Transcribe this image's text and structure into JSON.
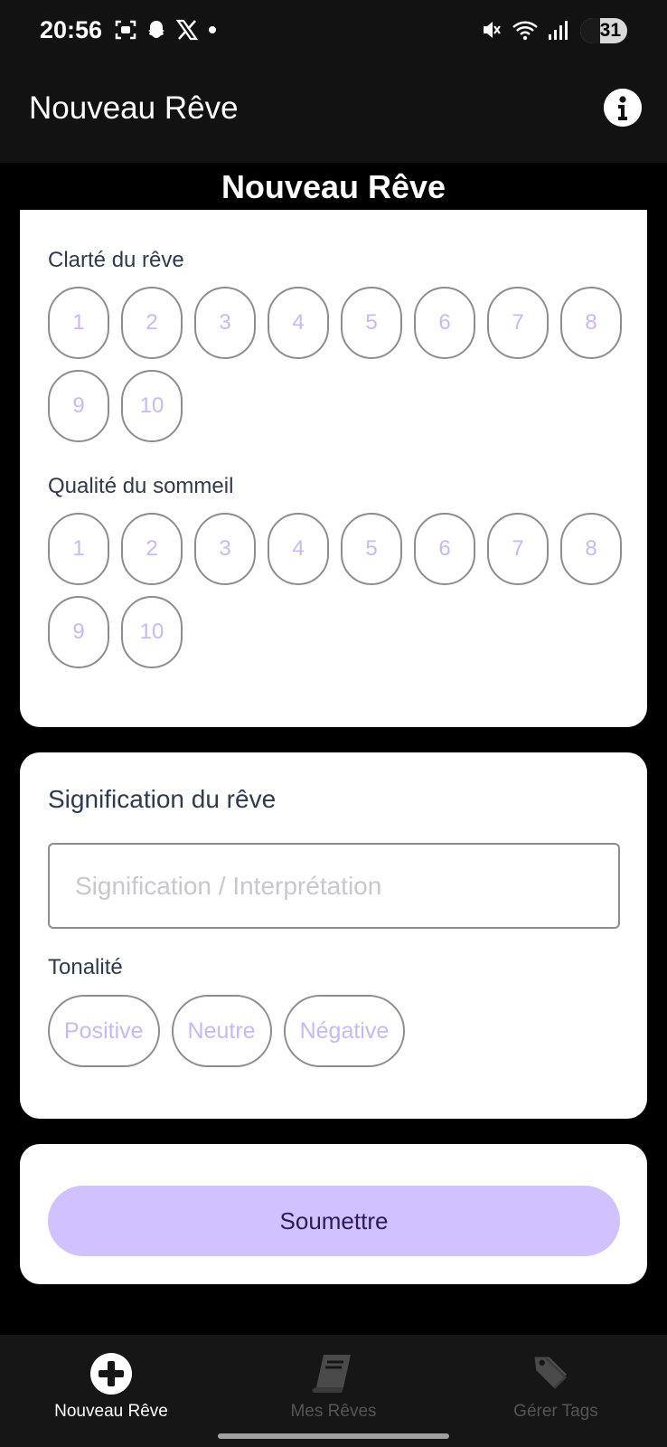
{
  "status": {
    "time": "20:56",
    "battery": "31",
    "left_icons": [
      "screenshot-icon",
      "snapchat-icon",
      "x-logo-icon",
      "dot-icon"
    ],
    "right_icons": [
      "mute-icon",
      "wifi-icon",
      "signal-icon"
    ]
  },
  "appbar": {
    "title": "Nouveau Rêve",
    "info_icon": "info-icon"
  },
  "page": {
    "heading": "Nouveau Rêve"
  },
  "clarity": {
    "label": "Clarté du rêve",
    "options": [
      "1",
      "2",
      "3",
      "4",
      "5",
      "6",
      "7",
      "8",
      "9",
      "10"
    ]
  },
  "sleep": {
    "label": "Qualité du sommeil",
    "options": [
      "1",
      "2",
      "3",
      "4",
      "5",
      "6",
      "7",
      "8",
      "9",
      "10"
    ]
  },
  "meaning": {
    "title": "Signification du rêve",
    "placeholder": "Signification / Interprétation",
    "value": ""
  },
  "tone": {
    "label": "Tonalité",
    "options": [
      "Positive",
      "Neutre",
      "Négative"
    ]
  },
  "submit": {
    "label": "Soumettre"
  },
  "nav": {
    "items": [
      {
        "label": "Nouveau Rêve",
        "icon": "plus-circle-icon",
        "active": true
      },
      {
        "label": "Mes Rêves",
        "icon": "book-icon",
        "active": false
      },
      {
        "label": "Gérer Tags",
        "icon": "tags-icon",
        "active": false
      }
    ]
  },
  "colors": {
    "accent": "#d2c1ff",
    "chip_text": "#c9b8f5",
    "label_text": "#2e3a4d",
    "nav_active": "#ffffff",
    "nav_inactive": "#555555"
  }
}
